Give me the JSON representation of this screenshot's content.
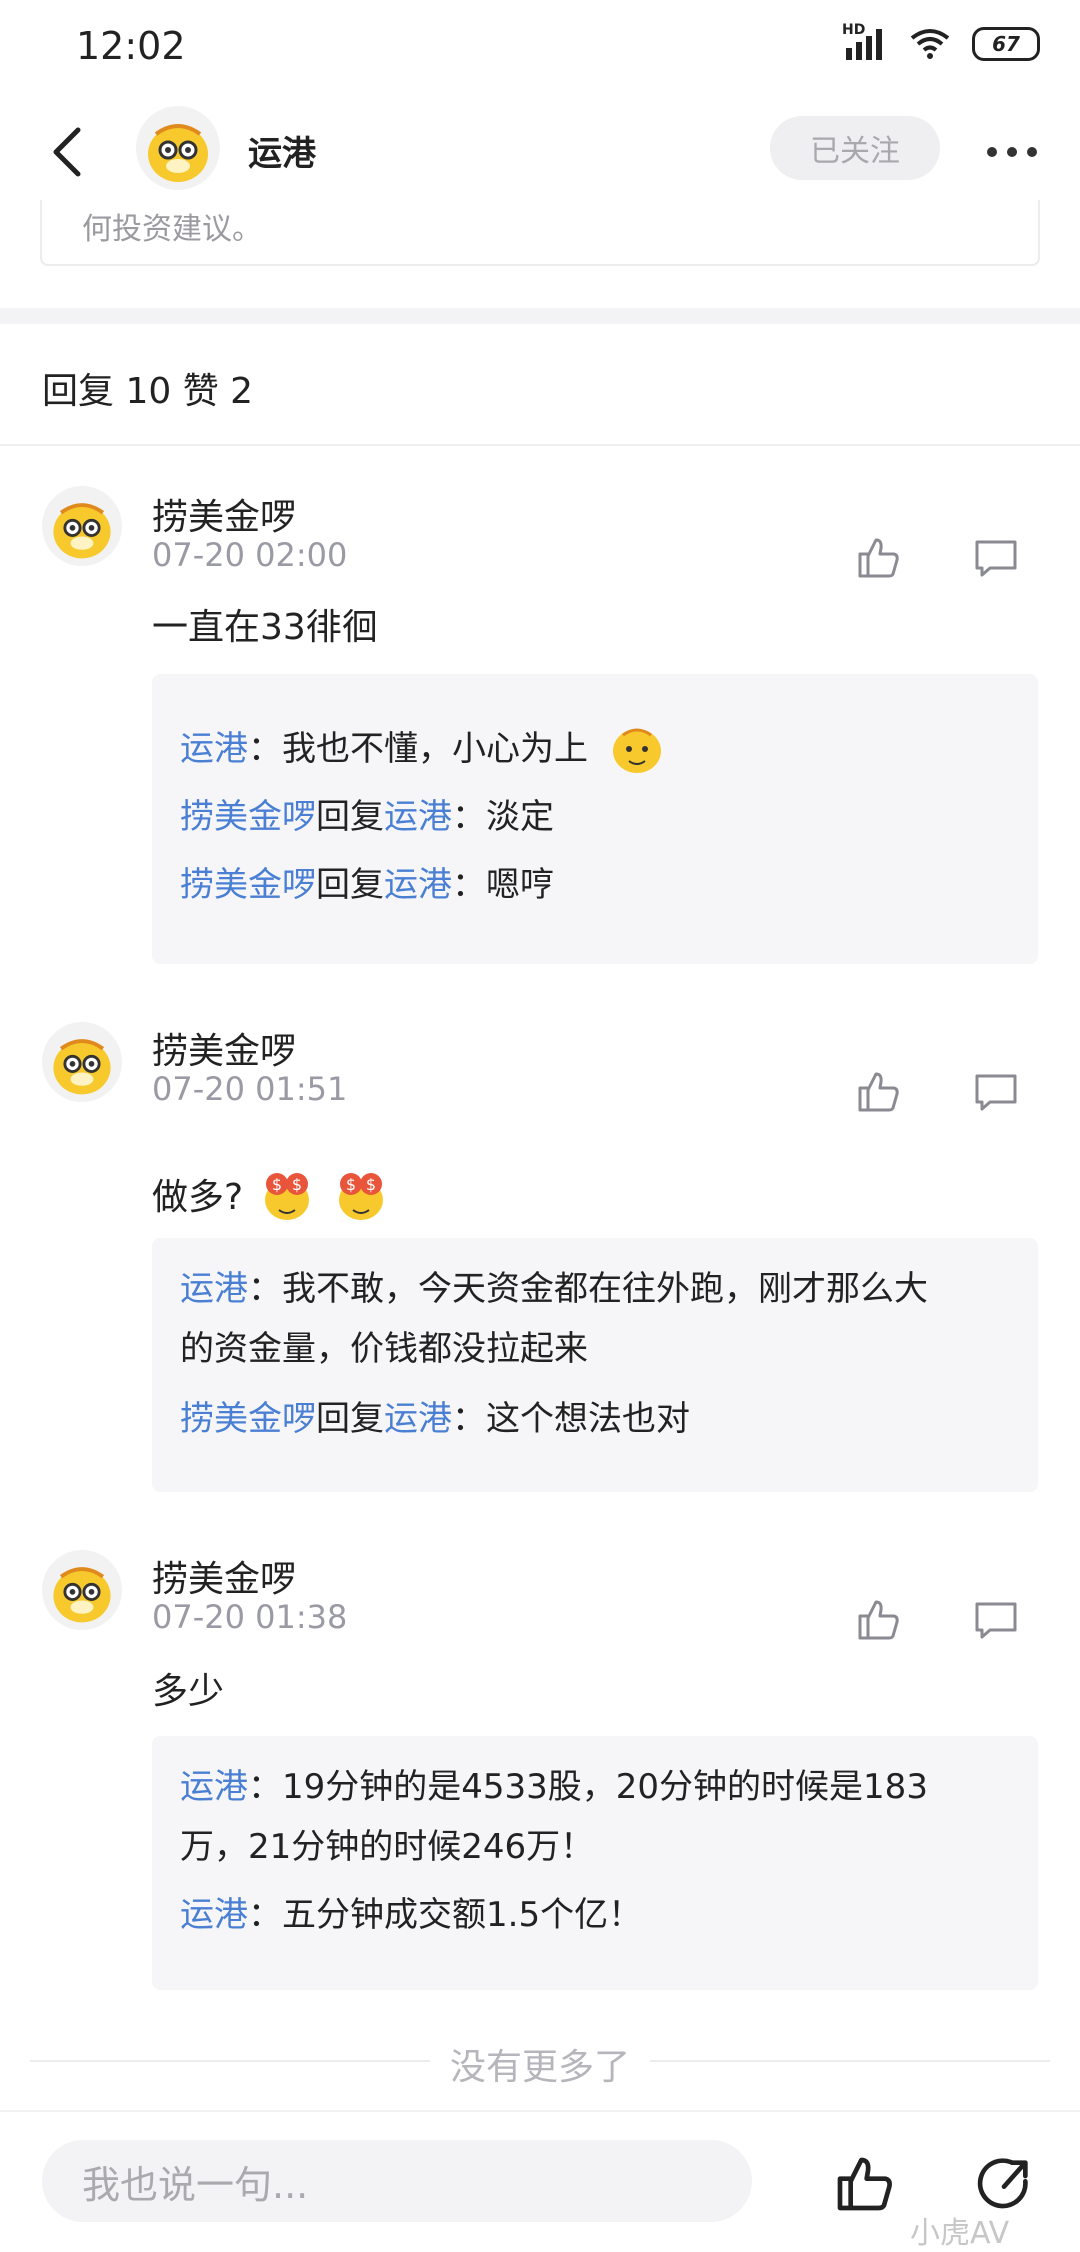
{
  "status_bar": {
    "time": "12:02",
    "network": "HD",
    "battery": "67"
  },
  "header": {
    "title": "运港",
    "follow_label": "已关注"
  },
  "post_tail_text": "何投资建议。",
  "reply_stats": "回复 10 赞 2",
  "comments": [
    {
      "name": "捞美金啰",
      "time": "07-20 02:00",
      "text": "一直在33徘徊",
      "replies": [
        {
          "user": "运港",
          "to": "",
          "text": "：我也不懂，小心为上"
        },
        {
          "user": "捞美金啰",
          "to": "运港",
          "reply_word": "回复",
          "text": "：淡定"
        },
        {
          "user": "捞美金啰",
          "to": "运港",
          "reply_word": "回复",
          "text": "：嗯哼"
        }
      ]
    },
    {
      "name": "捞美金啰",
      "time": "07-20 01:51",
      "text": "做多?",
      "replies": [
        {
          "user": "运港",
          "text_line1": "：我不敢，今天资金都在往外跑，刚才那么大",
          "text_line2": "的资金量，价钱都没拉起来"
        },
        {
          "user": "捞美金啰",
          "to": "运港",
          "reply_word": "回复",
          "text": "：这个想法也对"
        }
      ]
    },
    {
      "name": "捞美金啰",
      "time": "07-20 01:38",
      "text": "多少",
      "replies": [
        {
          "user": "运港",
          "text_line1": "：19分钟的是4533股，20分钟的时候是183",
          "text_line2": "万，21分钟的时候246万！"
        },
        {
          "user": "运港",
          "text": "：五分钟成交额1.5个亿！"
        }
      ]
    }
  ],
  "no_more": "没有更多了",
  "bottom_bar": {
    "input_placeholder": "我也说一句..."
  },
  "watermark": "小虎AV",
  "colors": {
    "link": "#4a7fd4",
    "tiger_yellow": "#f7c92c"
  }
}
